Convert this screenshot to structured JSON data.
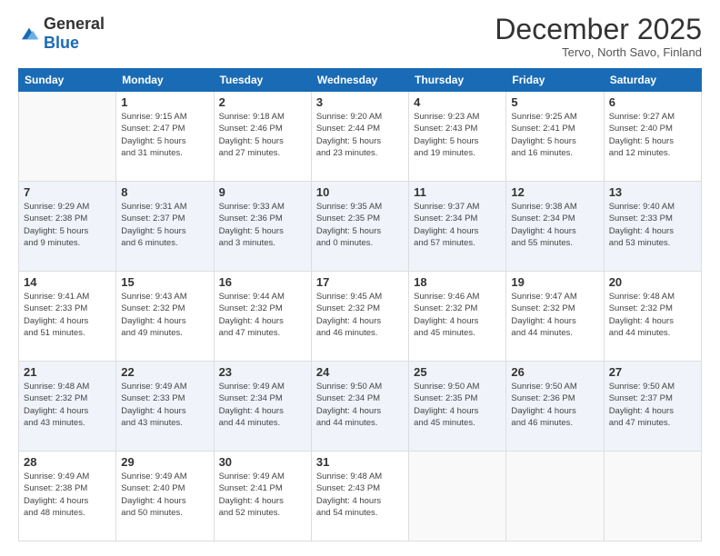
{
  "logo": {
    "general": "General",
    "blue": "Blue"
  },
  "header": {
    "month": "December 2025",
    "location": "Tervo, North Savo, Finland"
  },
  "weekdays": [
    "Sunday",
    "Monday",
    "Tuesday",
    "Wednesday",
    "Thursday",
    "Friday",
    "Saturday"
  ],
  "weeks": [
    [
      {
        "day": "",
        "info": ""
      },
      {
        "day": "1",
        "info": "Sunrise: 9:15 AM\nSunset: 2:47 PM\nDaylight: 5 hours\nand 31 minutes."
      },
      {
        "day": "2",
        "info": "Sunrise: 9:18 AM\nSunset: 2:46 PM\nDaylight: 5 hours\nand 27 minutes."
      },
      {
        "day": "3",
        "info": "Sunrise: 9:20 AM\nSunset: 2:44 PM\nDaylight: 5 hours\nand 23 minutes."
      },
      {
        "day": "4",
        "info": "Sunrise: 9:23 AM\nSunset: 2:43 PM\nDaylight: 5 hours\nand 19 minutes."
      },
      {
        "day": "5",
        "info": "Sunrise: 9:25 AM\nSunset: 2:41 PM\nDaylight: 5 hours\nand 16 minutes."
      },
      {
        "day": "6",
        "info": "Sunrise: 9:27 AM\nSunset: 2:40 PM\nDaylight: 5 hours\nand 12 minutes."
      }
    ],
    [
      {
        "day": "7",
        "info": "Sunrise: 9:29 AM\nSunset: 2:38 PM\nDaylight: 5 hours\nand 9 minutes."
      },
      {
        "day": "8",
        "info": "Sunrise: 9:31 AM\nSunset: 2:37 PM\nDaylight: 5 hours\nand 6 minutes."
      },
      {
        "day": "9",
        "info": "Sunrise: 9:33 AM\nSunset: 2:36 PM\nDaylight: 5 hours\nand 3 minutes."
      },
      {
        "day": "10",
        "info": "Sunrise: 9:35 AM\nSunset: 2:35 PM\nDaylight: 5 hours\nand 0 minutes."
      },
      {
        "day": "11",
        "info": "Sunrise: 9:37 AM\nSunset: 2:34 PM\nDaylight: 4 hours\nand 57 minutes."
      },
      {
        "day": "12",
        "info": "Sunrise: 9:38 AM\nSunset: 2:34 PM\nDaylight: 4 hours\nand 55 minutes."
      },
      {
        "day": "13",
        "info": "Sunrise: 9:40 AM\nSunset: 2:33 PM\nDaylight: 4 hours\nand 53 minutes."
      }
    ],
    [
      {
        "day": "14",
        "info": "Sunrise: 9:41 AM\nSunset: 2:33 PM\nDaylight: 4 hours\nand 51 minutes."
      },
      {
        "day": "15",
        "info": "Sunrise: 9:43 AM\nSunset: 2:32 PM\nDaylight: 4 hours\nand 49 minutes."
      },
      {
        "day": "16",
        "info": "Sunrise: 9:44 AM\nSunset: 2:32 PM\nDaylight: 4 hours\nand 47 minutes."
      },
      {
        "day": "17",
        "info": "Sunrise: 9:45 AM\nSunset: 2:32 PM\nDaylight: 4 hours\nand 46 minutes."
      },
      {
        "day": "18",
        "info": "Sunrise: 9:46 AM\nSunset: 2:32 PM\nDaylight: 4 hours\nand 45 minutes."
      },
      {
        "day": "19",
        "info": "Sunrise: 9:47 AM\nSunset: 2:32 PM\nDaylight: 4 hours\nand 44 minutes."
      },
      {
        "day": "20",
        "info": "Sunrise: 9:48 AM\nSunset: 2:32 PM\nDaylight: 4 hours\nand 44 minutes."
      }
    ],
    [
      {
        "day": "21",
        "info": "Sunrise: 9:48 AM\nSunset: 2:32 PM\nDaylight: 4 hours\nand 43 minutes."
      },
      {
        "day": "22",
        "info": "Sunrise: 9:49 AM\nSunset: 2:33 PM\nDaylight: 4 hours\nand 43 minutes."
      },
      {
        "day": "23",
        "info": "Sunrise: 9:49 AM\nSunset: 2:34 PM\nDaylight: 4 hours\nand 44 minutes."
      },
      {
        "day": "24",
        "info": "Sunrise: 9:50 AM\nSunset: 2:34 PM\nDaylight: 4 hours\nand 44 minutes."
      },
      {
        "day": "25",
        "info": "Sunrise: 9:50 AM\nSunset: 2:35 PM\nDaylight: 4 hours\nand 45 minutes."
      },
      {
        "day": "26",
        "info": "Sunrise: 9:50 AM\nSunset: 2:36 PM\nDaylight: 4 hours\nand 46 minutes."
      },
      {
        "day": "27",
        "info": "Sunrise: 9:50 AM\nSunset: 2:37 PM\nDaylight: 4 hours\nand 47 minutes."
      }
    ],
    [
      {
        "day": "28",
        "info": "Sunrise: 9:49 AM\nSunset: 2:38 PM\nDaylight: 4 hours\nand 48 minutes."
      },
      {
        "day": "29",
        "info": "Sunrise: 9:49 AM\nSunset: 2:40 PM\nDaylight: 4 hours\nand 50 minutes."
      },
      {
        "day": "30",
        "info": "Sunrise: 9:49 AM\nSunset: 2:41 PM\nDaylight: 4 hours\nand 52 minutes."
      },
      {
        "day": "31",
        "info": "Sunrise: 9:48 AM\nSunset: 2:43 PM\nDaylight: 4 hours\nand 54 minutes."
      },
      {
        "day": "",
        "info": ""
      },
      {
        "day": "",
        "info": ""
      },
      {
        "day": "",
        "info": ""
      }
    ]
  ]
}
